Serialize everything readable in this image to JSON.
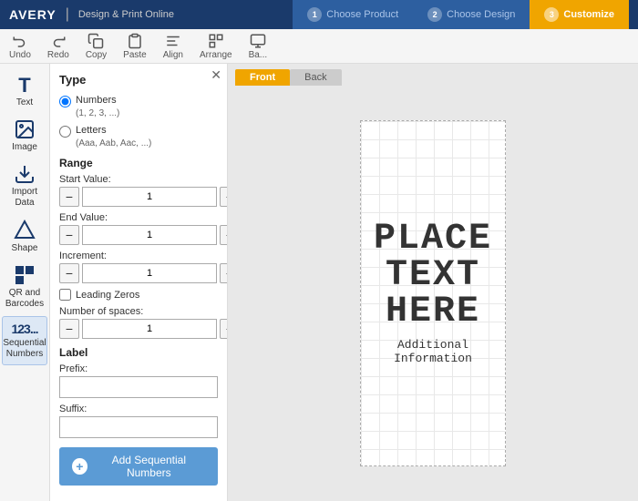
{
  "topNav": {
    "brand": "AVERY",
    "divider": "|",
    "subTitle": "Design & Print Online",
    "steps": [
      {
        "num": "1",
        "label": "Choose Product",
        "state": "inactive"
      },
      {
        "num": "2",
        "label": "Choose Design",
        "state": "inactive"
      },
      {
        "num": "3",
        "label": "Customize",
        "state": "active"
      }
    ]
  },
  "toolbar": {
    "items": [
      {
        "label": "Undo"
      },
      {
        "label": "Redo"
      },
      {
        "label": "Copy"
      },
      {
        "label": "Paste"
      },
      {
        "label": "Align"
      },
      {
        "label": "Arrange"
      },
      {
        "label": "Ba..."
      }
    ]
  },
  "tools": [
    {
      "id": "text",
      "label": "Text"
    },
    {
      "id": "image",
      "label": "Image"
    },
    {
      "id": "import",
      "label": "Import Data"
    },
    {
      "id": "shape",
      "label": "Shape"
    },
    {
      "id": "qr",
      "label": "QR and Barcodes"
    },
    {
      "id": "sequential",
      "label": "Sequential Numbers"
    }
  ],
  "panel": {
    "title": "Type",
    "typeOptions": [
      {
        "id": "numbers",
        "label": "Numbers",
        "sub": "(1, 2, 3, ...)"
      },
      {
        "id": "letters",
        "label": "Letters",
        "sub": "(Aaa, Aab, Aac, ...)"
      }
    ],
    "rangeTitle": "Range",
    "startValueLabel": "Start Value:",
    "startValue": "1",
    "endValueLabel": "End Value:",
    "endValue": "1",
    "incrementLabel": "Increment:",
    "incrementValue": "1",
    "leadingZerosLabel": "Leading Zeros",
    "numSpacesLabel": "Number of spaces:",
    "numSpacesValue": "1",
    "labelTitle": "Label",
    "prefixLabel": "Prefix:",
    "suffixLabel": "Suffix:",
    "addBtnLabel": "Add Sequential Numbers"
  },
  "canvas": {
    "tabs": [
      {
        "label": "Front",
        "state": "active"
      },
      {
        "label": "Back",
        "state": "inactive"
      }
    ],
    "labelLines": [
      "Place",
      "Text",
      "Here"
    ],
    "additionalText": "Additional\nInformation"
  }
}
